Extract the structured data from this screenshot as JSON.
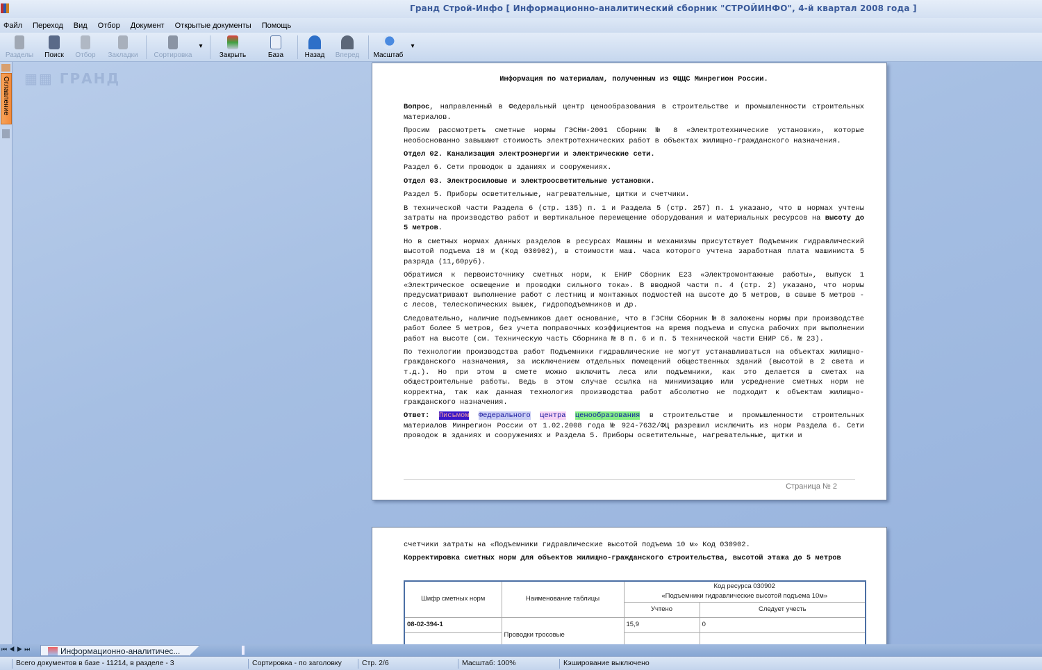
{
  "window": {
    "title": "Гранд Строй-Инфо  [ Информационно-аналитический сборник \"СТРОЙИНФО\", 4-й квартал 2008 года ]"
  },
  "menu": [
    "Файл",
    "Переход",
    "Вид",
    "Отбор",
    "Документ",
    "Открытые документы",
    "Помощь"
  ],
  "toolbar": {
    "sections": "Разделы",
    "search": "Поиск",
    "filter": "Отбор",
    "bookmarks": "Закладки",
    "sort": "Сортировка",
    "close": "Закрыть",
    "base": "База",
    "back": "Назад",
    "forward": "Вперед",
    "zoom": "Масштаб"
  },
  "side": {
    "toc_tab": "Оглавление",
    "logo": "ГРАНД"
  },
  "page1": {
    "title": "Информация по материалам, полученным из ФЦЦС Минрегион России.",
    "p1_bold": "Вопрос",
    "p1": ", направленный в Федеральный центр ценообразования в строительстве и промышленности строительных материалов.",
    "p2": "Просим рассмотреть  сметные нормы  ГЭСНм-2001 Сборник № 8 «Электротехнические установки», которые необоснованно завышают стоимость электротехнических работ в объектах жилищно-гражданского назначения.",
    "p3": "Отдел 02. Канализация электроэнергии и электрические сети.",
    "p4": "Раздел 6. Сети проводок в зданиях и сооружениях.",
    "p5": "Отдел 03. Электросиловые и электроосветительные установки.",
    "p6": "Раздел 5. Приборы осветительные, нагревательные, щитки и счетчики.",
    "p7": "В технической части Раздела 6 (стр. 135) п. 1 и Раздела 5 (стр. 257) п. 1  указано, что в нормах учтены затраты на производство работ и вертикальное перемещение оборудования и материальных ресурсов на ",
    "p7_bold": "высоту до 5 метров",
    "p8": "Но в сметных нормах данных разделов в ресурсах Машины и механизмы присутствует Подъемник гидравлический высотой подъема 10 м (Код 030902), в стоимости маш. часа которого учтена заработная плата  машиниста 5 разряда (11,60руб).",
    "p9": "Обратимся к первоисточнику сметных норм, к ЕНИР Сборник Е23 «Электромонтажные работы», выпуск 1 «Электрическое освещение и проводки сильного тока». В вводной части п. 4 (стр. 2) указано, что нормы предусматривают выполнение работ с лестниц и монтажных подмостей на высоте до 5 метров, в свыше 5 метров - с лесов, телескопических вышек, гидроподъемников и др.",
    "p10": "Следовательно,  наличие подъемников дает основание, что в ГЭСНм Сборник № 8 заложены нормы  при производстве работ более 5 метров, без учета поправочных коэффициентов на время подъема и спуска рабочих при выполнении работ на высоте (см. Техническую часть Сборника № 8 п. 6 и п. 5 технической части ЕНИР Сб. № 23).",
    "p11": "По технологии производства работ Подъемники гидравлические не могут устанавливаться на объектах жилищно-гражданского назначения, за исключением отдельных  помещений общественных зданий (высотой в 2 света и т.д.). Но при этом в смете можно включить леса или подъемники, как это делается  в сметах на общестроительные работы. Ведь в этом случае ссылка на минимизацию или усреднение сметных норм не корректна, так как данная технология производства работ абсолютно не подходит к объектам жилищно-гражданского назначения.",
    "ans_label": "Ответ:",
    "ans_h1": "Письмом",
    "ans_h2": "Федерального",
    "ans_h3": "центра",
    "ans_h4": "ценообразования",
    "ans_rest": " в строительстве и промышленности строительных материалов Минрегион России от 1.02.2008 года № 924-7632/ФЦ разрешил исключить из норм  Раздела 6. Сети проводок в зданиях и сооружениях и Раздела 5. Приборы осветительные, нагревательные, щитки и",
    "footer": "Страница № 2"
  },
  "page2": {
    "p1": "счетчики затраты на «Подъемники гидравлические высотой подъема 10 м» Код 030902.",
    "p2": "Корректировка сметных норм для объектов жилищно-гражданского строительства, высотой этажа до 5 метров",
    "table": {
      "h_code": "Шифр сметных норм",
      "h_name": "Наименование таблицы",
      "h_res1": "Код ресурса 030902",
      "h_res2": "«Подъемники гидравлические высотой подъема 10м»",
      "h_counted": "Учтено",
      "h_should": "Следует учесть",
      "rows": [
        {
          "code": "08-02-394-1",
          "name": "Проводки тросовые",
          "counted": "15,9",
          "should": "0"
        }
      ]
    }
  },
  "tabs": {
    "doc_tab": "Информационно-аналитичес..."
  },
  "status": {
    "total": "Всего документов в базе - 11214, в разделе - 3",
    "sort": "Сортировка - по заголовку",
    "page": "Стр. 2/6",
    "zoom": "Масштаб: 100%",
    "cache": "Кэширование выключено"
  }
}
